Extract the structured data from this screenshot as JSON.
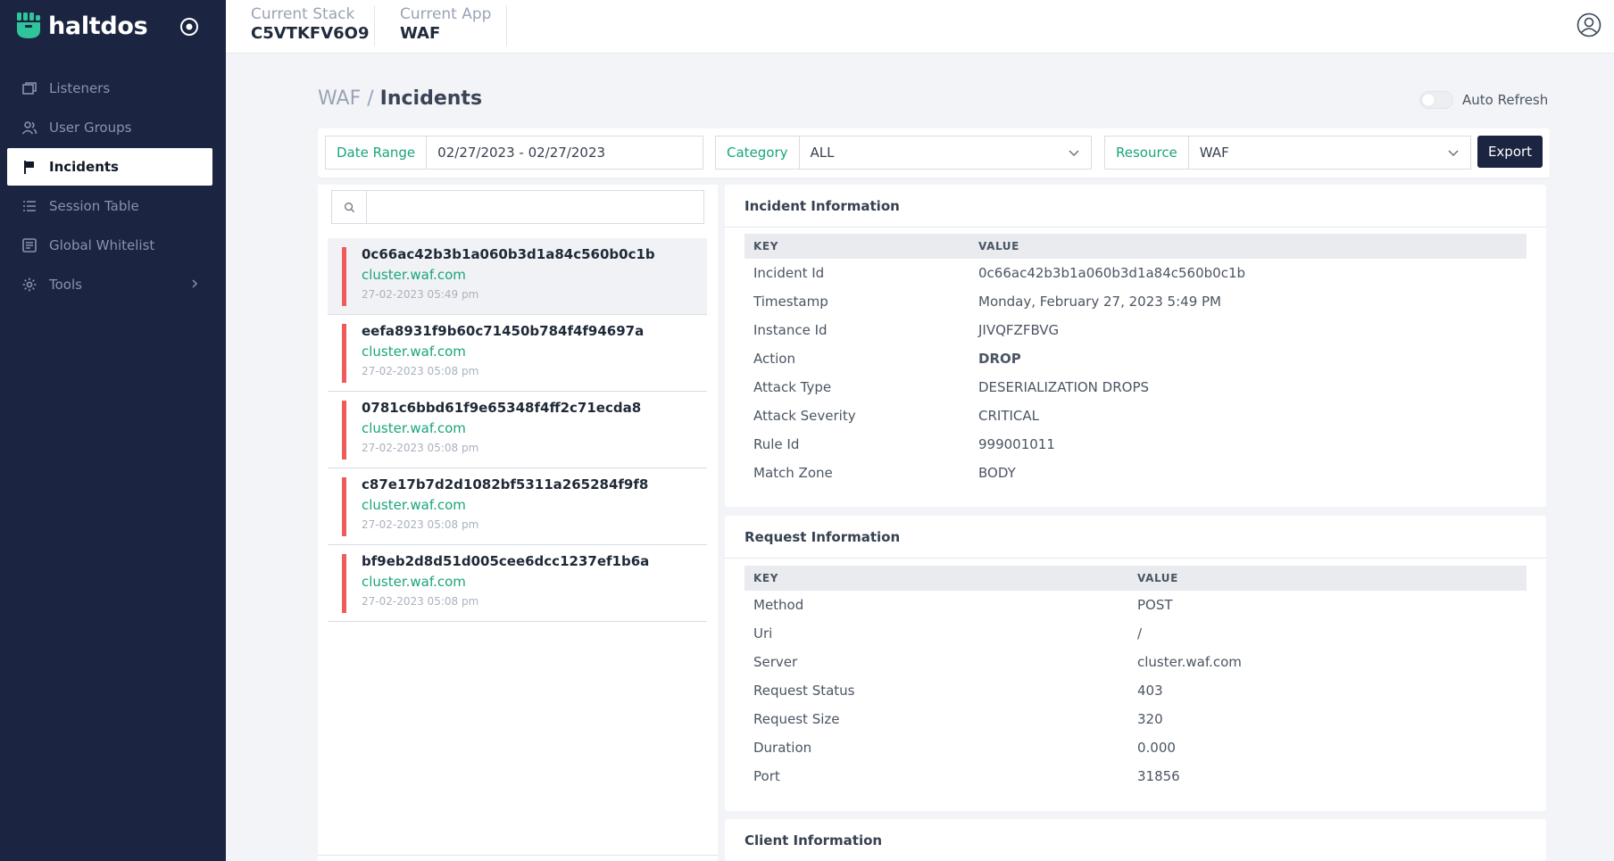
{
  "brand": {
    "name": "haltdos"
  },
  "sidebar": {
    "items": [
      {
        "label": "Listeners",
        "icon": "listeners-icon",
        "active": false
      },
      {
        "label": "User Groups",
        "icon": "user-groups-icon",
        "active": false
      },
      {
        "label": "Incidents",
        "icon": "flag-icon",
        "active": true
      },
      {
        "label": "Session Table",
        "icon": "list-icon",
        "active": false
      },
      {
        "label": "Global Whitelist",
        "icon": "whitelist-icon",
        "active": false
      },
      {
        "label": "Tools",
        "icon": "gear-icon",
        "active": false,
        "has_submenu": true
      }
    ]
  },
  "header": {
    "stack_label": "Current Stack",
    "stack_value": "C5VTKFV6O9",
    "app_label": "Current App",
    "app_value": "WAF"
  },
  "page": {
    "breadcrumb_parent": "WAF",
    "breadcrumb_sep": " / ",
    "title": "Incidents",
    "auto_refresh_label": "Auto Refresh",
    "auto_refresh_on": false
  },
  "filters": {
    "date_label": "Date Range",
    "date_value": "02/27/2023 - 02/27/2023",
    "category_label": "Category",
    "category_value": "ALL",
    "resource_label": "Resource",
    "resource_value": "WAF",
    "export_label": "Export"
  },
  "search": {
    "placeholder": ""
  },
  "incidents": [
    {
      "id": "0c66ac42b3b1a060b3d1a84c560b0c1b",
      "host": "cluster.waf.com",
      "time": "27-02-2023 05:49 pm"
    },
    {
      "id": "eefa8931f9b60c71450b784f4f94697a",
      "host": "cluster.waf.com",
      "time": "27-02-2023 05:08 pm"
    },
    {
      "id": "0781c6bbd61f9e65348f4ff2c71ecda8",
      "host": "cluster.waf.com",
      "time": "27-02-2023 05:08 pm"
    },
    {
      "id": "c87e17b7d2d1082bf5311a265284f9f8",
      "host": "cluster.waf.com",
      "time": "27-02-2023 05:08 pm"
    },
    {
      "id": "bf9eb2d8d51d005cee6dcc1237ef1b6a",
      "host": "cluster.waf.com",
      "time": "27-02-2023 05:08 pm"
    }
  ],
  "incident_info": {
    "title": "Incident Information",
    "key_header": "KEY",
    "value_header": "VALUE",
    "rows": [
      {
        "key": "Incident Id",
        "value": "0c66ac42b3b1a060b3d1a84c560b0c1b"
      },
      {
        "key": "Timestamp",
        "value": "Monday, February 27, 2023 5:49 PM"
      },
      {
        "key": "Instance Id",
        "value": "JIVQFZFBVG"
      },
      {
        "key": "Action",
        "value": "DROP"
      },
      {
        "key": "Attack Type",
        "value": "DESERIALIZATION DROPS"
      },
      {
        "key": "Attack Severity",
        "value": "CRITICAL"
      },
      {
        "key": "Rule Id",
        "value": "999001011"
      },
      {
        "key": "Match Zone",
        "value": "BODY"
      }
    ]
  },
  "request_info": {
    "title": "Request Information",
    "key_header": "KEY",
    "value_header": "VALUE",
    "rows": [
      {
        "key": "Method",
        "value": "POST"
      },
      {
        "key": "Uri",
        "value": "/"
      },
      {
        "key": "Server",
        "value": "cluster.waf.com"
      },
      {
        "key": "Request Status",
        "value": "403"
      },
      {
        "key": "Request Size",
        "value": "320"
      },
      {
        "key": "Duration",
        "value": "0.000"
      },
      {
        "key": "Port",
        "value": "31856"
      }
    ]
  },
  "client_info": {
    "title": "Client Information"
  },
  "colors": {
    "sidebar_bg": "#1b2440",
    "accent_green": "#19a57c",
    "severity_red": "#ef5a5a"
  }
}
